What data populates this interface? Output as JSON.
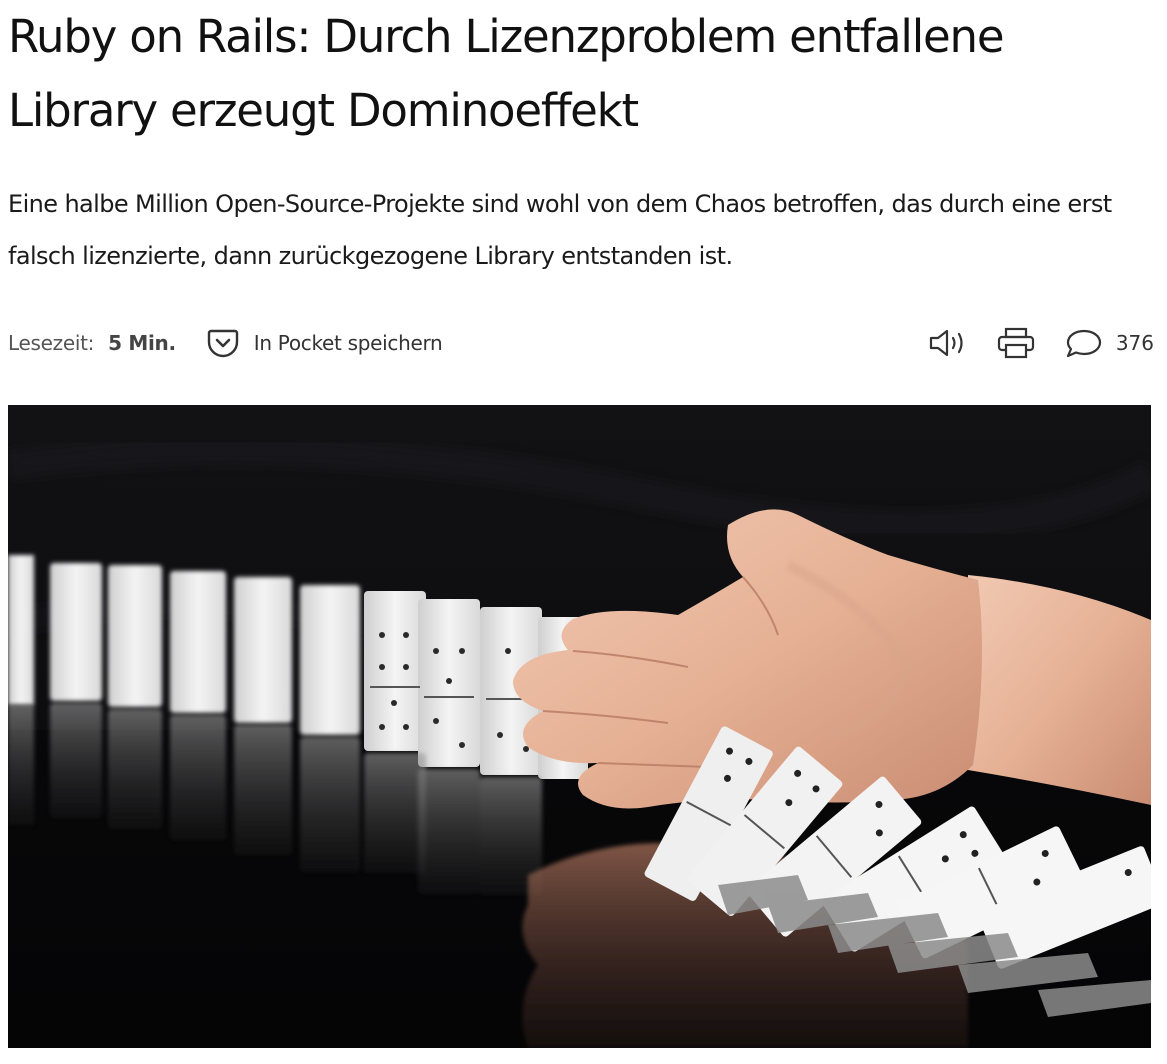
{
  "article": {
    "title": "Ruby on Rails: Durch Lizenzproblem entfallene Library erzeugt Dominoeffekt",
    "lead": "Eine halbe Million Open-Source-Projekte sind wohl von dem Chaos betroffen, das durch eine erst falsch lizenzierte, dann zurückgezogene Library entstanden ist."
  },
  "meta": {
    "reading_time_label": "Lesezeit:",
    "reading_time_value": "5 Min.",
    "pocket_label": "In Pocket speichern",
    "comment_count": "376"
  },
  "icons": {
    "pocket": "pocket-icon",
    "audio": "speaker-icon",
    "print": "printer-icon",
    "comments": "comment-bubble-icon"
  },
  "colors": {
    "text": "#1a1a1a",
    "muted": "#555555",
    "icon": "#333333",
    "image_background": "#0d0d0f"
  }
}
